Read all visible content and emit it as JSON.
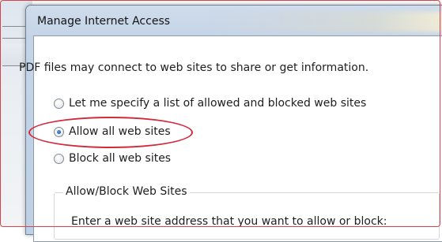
{
  "dialog": {
    "title": "Manage Internet Access",
    "description": "PDF files may connect to web sites to share or get information."
  },
  "options": [
    {
      "label": "Let me specify a list of allowed and blocked web sites",
      "checked": false
    },
    {
      "label": "Allow all web sites",
      "checked": true
    },
    {
      "label": "Block all web sites",
      "checked": false
    }
  ],
  "group": {
    "label": "Allow/Block Web Sites",
    "instruction": "Enter a web site address that you want to allow or block:"
  },
  "colors": {
    "annotation_red": "#d22a3a",
    "title_bar": "#c5d5e7"
  }
}
